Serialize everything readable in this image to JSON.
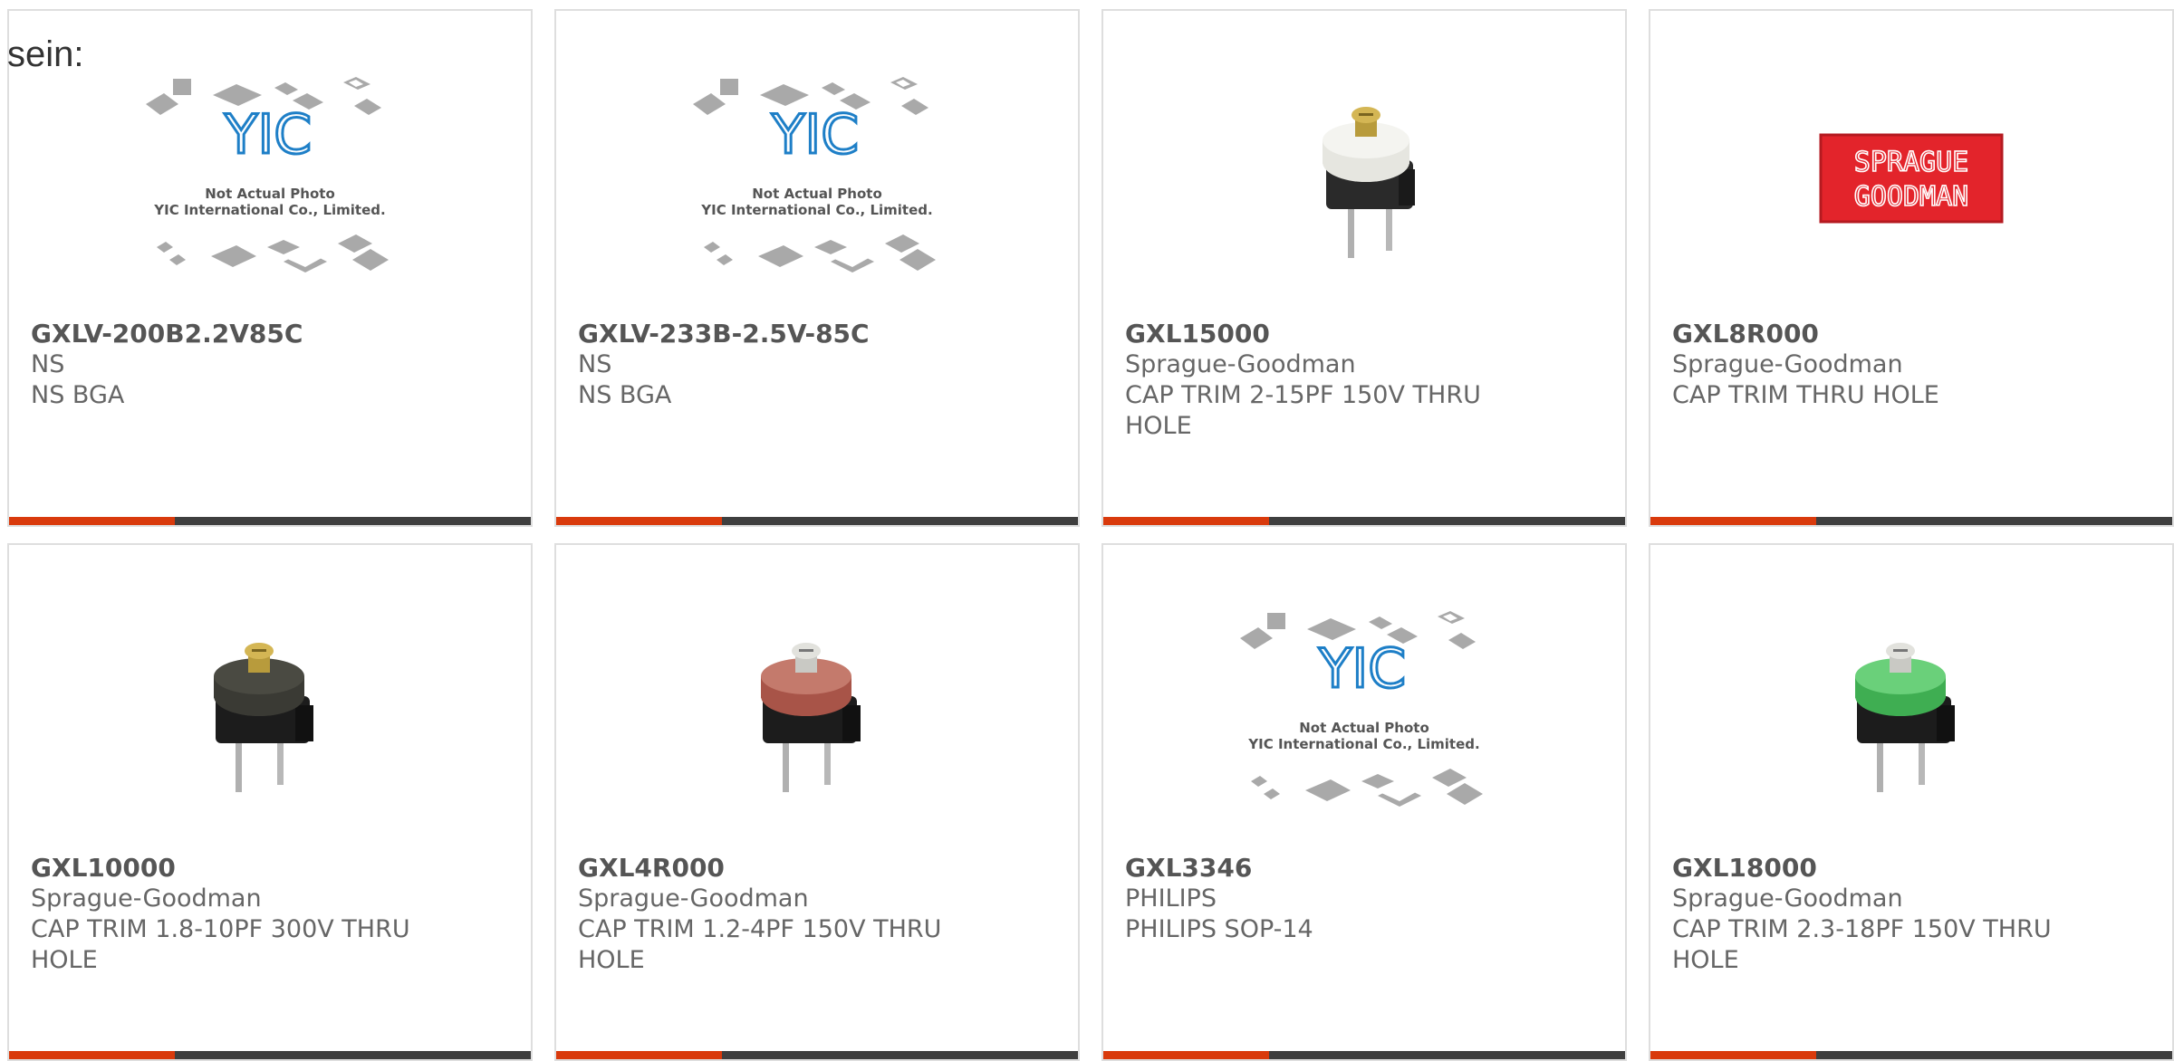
{
  "intro": "sein:",
  "colors": {
    "accent": "#d93a0c",
    "bar": "#3f3f3f",
    "border": "#dedede"
  },
  "products": [
    {
      "part": "GXLV-200B2.2V85C",
      "mfr": "NS",
      "desc": "NS BGA",
      "image": "yic-placeholder",
      "ph1": "Not Actual Photo",
      "ph2": "YIC International Co., Limited.",
      "logo": "YIC"
    },
    {
      "part": "GXLV-233B-2.5V-85C",
      "mfr": "NS",
      "desc": "NS BGA",
      "image": "yic-placeholder",
      "ph1": "Not Actual Photo",
      "ph2": "YIC International Co., Limited.",
      "logo": "YIC"
    },
    {
      "part": "GXL15000",
      "mfr": "Sprague-Goodman",
      "desc": "CAP TRIM 2-15PF 150V THRU HOLE",
      "image": "trimmer-white"
    },
    {
      "part": "GXL8R000",
      "mfr": "Sprague-Goodman",
      "desc": "CAP TRIM THRU HOLE",
      "image": "sprague-logo",
      "logo1": "SPRAGUE",
      "logo2": "GOODMAN"
    },
    {
      "part": "GXL10000",
      "mfr": "Sprague-Goodman",
      "desc": "CAP TRIM 1.8-10PF 300V THRU HOLE",
      "image": "trimmer-dark"
    },
    {
      "part": "GXL4R000",
      "mfr": "Sprague-Goodman",
      "desc": "CAP TRIM 1.2-4PF 150V THRU HOLE",
      "image": "trimmer-red"
    },
    {
      "part": "GXL3346",
      "mfr": "PHILIPS",
      "desc": "PHILIPS SOP-14",
      "image": "yic-placeholder",
      "ph1": "Not Actual Photo",
      "ph2": "YIC International Co., Limited.",
      "logo": "YIC"
    },
    {
      "part": "GXL18000",
      "mfr": "Sprague-Goodman",
      "desc": "CAP TRIM 2.3-18PF 150V THRU HOLE",
      "image": "trimmer-green"
    }
  ]
}
